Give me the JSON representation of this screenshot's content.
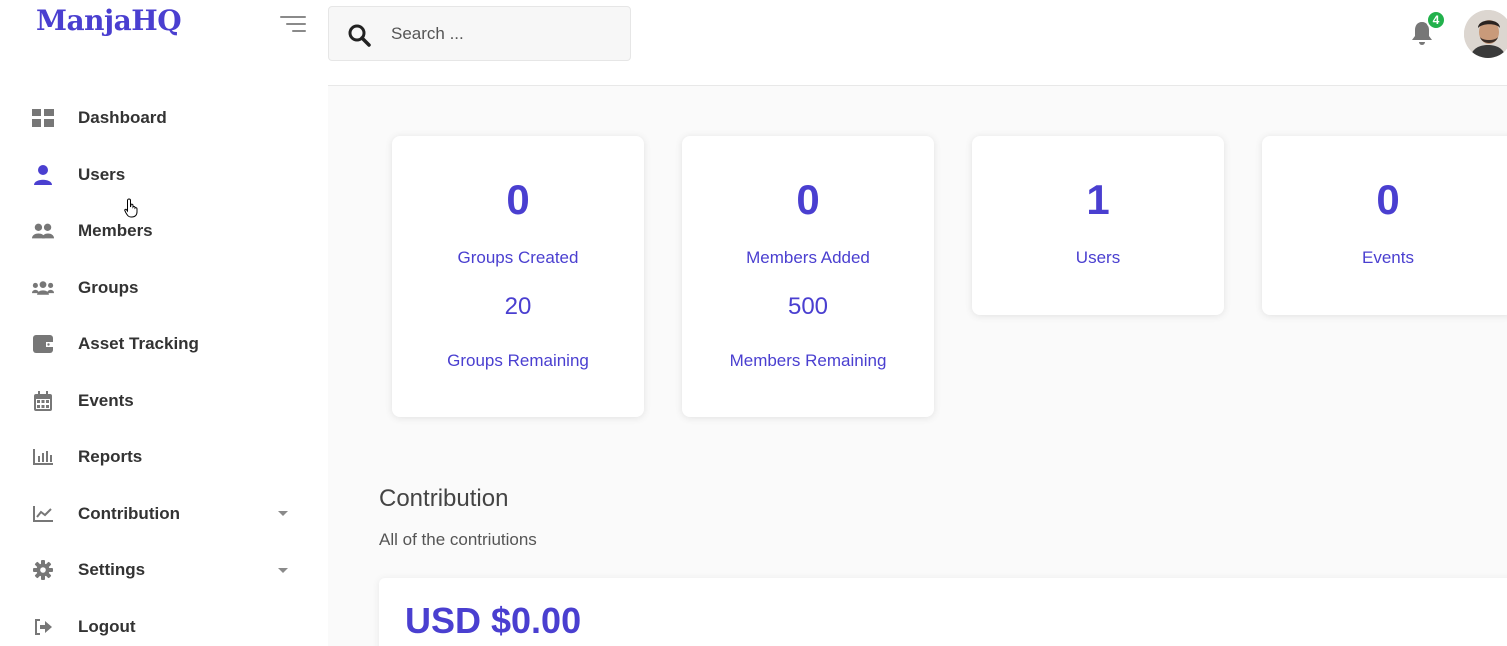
{
  "brand": {
    "name": "ManjaHQ",
    "accent": "#4a3fd0"
  },
  "search": {
    "placeholder": "Search ..."
  },
  "notifications": {
    "count": "4"
  },
  "sidebar": {
    "items": [
      {
        "label": "Dashboard",
        "icon": "dashboard-icon"
      },
      {
        "label": "Users",
        "icon": "user-icon"
      },
      {
        "label": "Members",
        "icon": "members-icon"
      },
      {
        "label": "Groups",
        "icon": "groups-icon"
      },
      {
        "label": "Asset Tracking",
        "icon": "wallet-icon"
      },
      {
        "label": "Events",
        "icon": "calendar-icon"
      },
      {
        "label": "Reports",
        "icon": "bar-chart-icon"
      },
      {
        "label": "Contribution",
        "icon": "line-chart-icon",
        "has_submenu": true
      },
      {
        "label": "Settings",
        "icon": "gear-icon",
        "has_submenu": true
      },
      {
        "label": "Logout",
        "icon": "logout-icon"
      }
    ]
  },
  "stats": {
    "groups": {
      "value": "0",
      "label": "Groups Created",
      "remaining_value": "20",
      "remaining_label": "Groups Remaining"
    },
    "members": {
      "value": "0",
      "label": "Members Added",
      "remaining_value": "500",
      "remaining_label": "Members Remaining"
    },
    "users": {
      "value": "1",
      "label": "Users"
    },
    "events": {
      "value": "0",
      "label": "Events"
    }
  },
  "contribution": {
    "title": "Contribution",
    "subtitle": "All of the contriutions",
    "total": "USD $0.00"
  }
}
